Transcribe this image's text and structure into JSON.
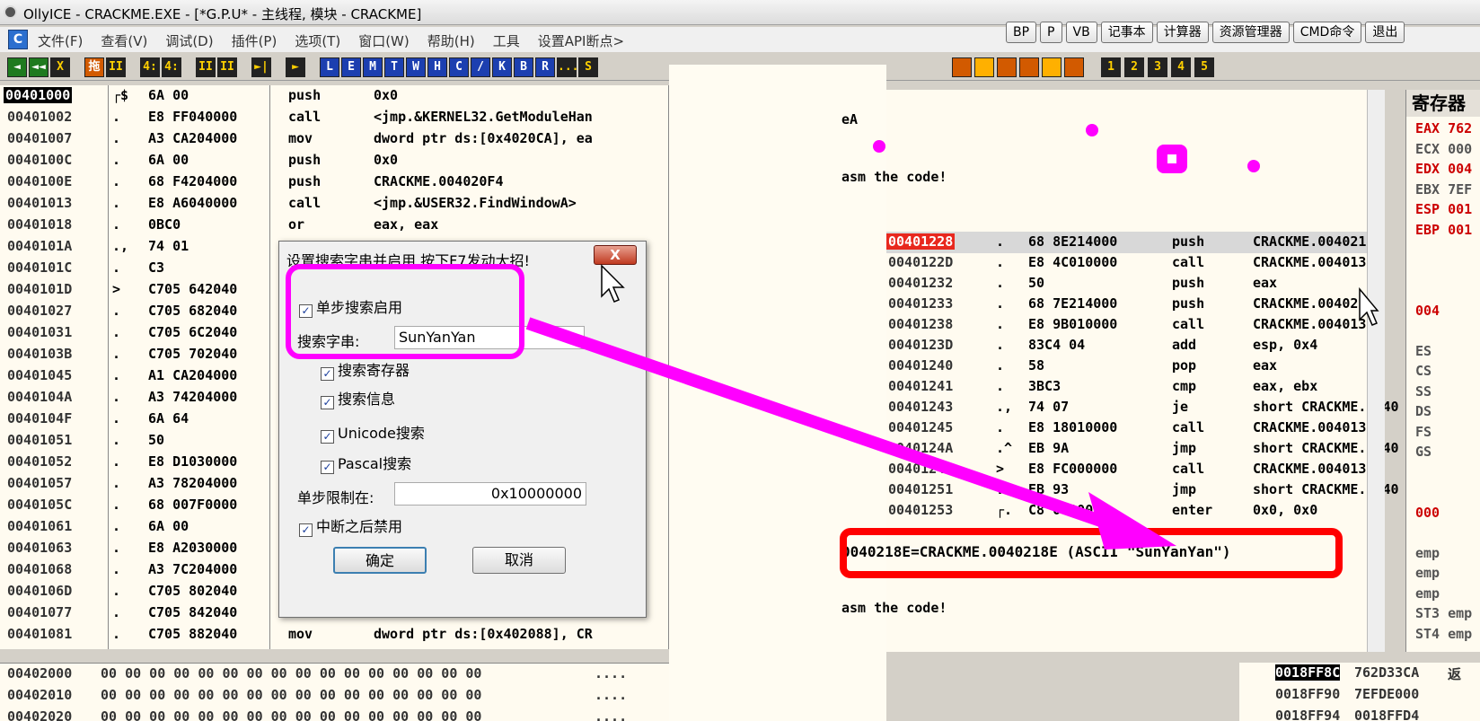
{
  "window": {
    "title": "OllyICE - CRACKME.EXE - [*G.P.U* -  主线程, 模块 - CRACKME]"
  },
  "menu": {
    "items": [
      "文件(F)",
      "查看(V)",
      "调试(D)",
      "插件(P)",
      "选项(T)",
      "窗口(W)",
      "帮助(H)",
      "工具",
      "设置API断点>"
    ]
  },
  "quick_buttons": [
    "BP",
    "P",
    "VB",
    "记事本",
    "计算器",
    "资源管理器",
    "CMD命令",
    "退出"
  ],
  "toolbar_left": [
    "◄",
    "◄◄",
    "X",
    "拖",
    "II",
    "4:",
    "4:",
    "II",
    "II",
    "►|",
    "►",
    "L",
    "E",
    "M",
    "T",
    "W",
    "H",
    "C",
    "/",
    "K",
    "B",
    "R",
    "...",
    "S"
  ],
  "toolbar_right": [
    "1",
    "2",
    "3",
    "4",
    "5"
  ],
  "disasm": [
    {
      "addr": "00401000",
      "sym": "┌$",
      "hex": "6A 00",
      "op": "push",
      "arg": "0x0",
      "sel": true
    },
    {
      "addr": "00401002",
      "sym": ".",
      "hex": "E8 FF040000",
      "op": "call",
      "arg": "<jmp.&KERNEL32.GetModuleHan"
    },
    {
      "addr": "00401007",
      "sym": ".",
      "hex": "A3 CA204000",
      "op": "mov",
      "arg": "dword ptr ds:[0x4020CA], ea"
    },
    {
      "addr": "0040100C",
      "sym": ".",
      "hex": "6A 00",
      "op": "push",
      "arg": "0x0"
    },
    {
      "addr": "0040100E",
      "sym": ".",
      "hex": "68 F4204000",
      "op": "push",
      "arg": "CRACKME.004020F4"
    },
    {
      "addr": "00401013",
      "sym": ".",
      "hex": "E8 A6040000",
      "op": "call",
      "arg": "<jmp.&USER32.FindWindowA>"
    },
    {
      "addr": "00401018",
      "sym": ".",
      "hex": "0BC0",
      "op": "or",
      "arg": "eax, eax"
    },
    {
      "addr": "0040101A",
      "sym": ".,",
      "hex": "74 01",
      "op": "",
      "arg": ""
    },
    {
      "addr": "0040101C",
      "sym": ".",
      "hex": "C3",
      "op": "",
      "arg": ""
    },
    {
      "addr": "0040101D",
      "sym": ">",
      "hex": "C705 642040",
      "op": "",
      "arg": ""
    },
    {
      "addr": "00401027",
      "sym": ".",
      "hex": "C705 682040",
      "op": "",
      "arg": ""
    },
    {
      "addr": "00401031",
      "sym": ".",
      "hex": "C705 6C2040",
      "op": "",
      "arg": ""
    },
    {
      "addr": "0040103B",
      "sym": ".",
      "hex": "C705 702040",
      "op": "",
      "arg": ""
    },
    {
      "addr": "00401045",
      "sym": ".",
      "hex": "A1 CA204000",
      "op": "",
      "arg": ""
    },
    {
      "addr": "0040104A",
      "sym": ".",
      "hex": "A3 74204000",
      "op": "",
      "arg": ""
    },
    {
      "addr": "0040104F",
      "sym": ".",
      "hex": "6A 64",
      "op": "",
      "arg": ""
    },
    {
      "addr": "00401051",
      "sym": ".",
      "hex": "50",
      "op": "",
      "arg": ""
    },
    {
      "addr": "00401052",
      "sym": ".",
      "hex": "E8 D1030000",
      "op": "",
      "arg": ""
    },
    {
      "addr": "00401057",
      "sym": ".",
      "hex": "A3 78204000",
      "op": "",
      "arg": ""
    },
    {
      "addr": "0040105C",
      "sym": ".",
      "hex": "68 007F0000",
      "op": "",
      "arg": ""
    },
    {
      "addr": "00401061",
      "sym": ".",
      "hex": "6A 00",
      "op": "",
      "arg": ""
    },
    {
      "addr": "00401063",
      "sym": ".",
      "hex": "E8 A2030000",
      "op": "",
      "arg": ""
    },
    {
      "addr": "00401068",
      "sym": ".",
      "hex": "A3 7C204000",
      "op": "",
      "arg": ""
    },
    {
      "addr": "0040106D",
      "sym": ".",
      "hex": "C705 802040",
      "op": "",
      "arg": ""
    },
    {
      "addr": "00401077",
      "sym": ".",
      "hex": "C705 842040",
      "op": "",
      "arg": ""
    },
    {
      "addr": "00401081",
      "sym": ".",
      "hex": "C705 882040",
      "op": "mov",
      "arg": "dword ptr ds:[0x402088], CR"
    }
  ],
  "right_disasm": [
    {
      "addr": "00401228",
      "sym": ".",
      "hex": "68 8E214000",
      "op": "push",
      "arg": "CRACKME.0040218E",
      "hl": true
    },
    {
      "addr": "0040122D",
      "sym": ".",
      "hex": "E8 4C010000",
      "op": "call",
      "arg": "CRACKME.0040137E"
    },
    {
      "addr": "00401232",
      "sym": ".",
      "hex": "50",
      "op": "push",
      "arg": "eax"
    },
    {
      "addr": "00401233",
      "sym": ".",
      "hex": "68 7E214000",
      "op": "push",
      "arg": "CRACKME.0040217E"
    },
    {
      "addr": "00401238",
      "sym": ".",
      "hex": "E8 9B010000",
      "op": "call",
      "arg": "CRACKME.004013D8"
    },
    {
      "addr": "0040123D",
      "sym": ".",
      "hex": "83C4 04",
      "op": "add",
      "arg": "esp, 0x4"
    },
    {
      "addr": "00401240",
      "sym": ".",
      "hex": "58",
      "op": "pop",
      "arg": "eax"
    },
    {
      "addr": "00401241",
      "sym": ".",
      "hex": "3BC3",
      "op": "cmp",
      "arg": "eax, ebx"
    },
    {
      "addr": "00401243",
      "sym": ".,",
      "hex": "74 07",
      "op": "je",
      "arg": "short CRACKME.0040"
    },
    {
      "addr": "00401245",
      "sym": ".",
      "hex": "E8 18010000",
      "op": "call",
      "arg": "CRACKME.00401362"
    },
    {
      "addr": "0040124A",
      "sym": ".^",
      "hex": "EB 9A",
      "op": "jmp",
      "arg": "short CRACKME.0040"
    },
    {
      "addr": "0040124C",
      "sym": ">",
      "hex": "E8 FC000000",
      "op": "call",
      "arg": "CRACKME.0040134D"
    },
    {
      "addr": "00401251",
      "sym": ".^",
      "hex": "EB 93",
      "op": "jmp",
      "arg": "short CRACKME.0040"
    },
    {
      "addr": "00401253",
      "sym": "┌.",
      "hex": "C8 000000",
      "op": "enter",
      "arg": "0x0, 0x0"
    }
  ],
  "right_top": {
    "line1": "eA",
    "line2": "asm the code!"
  },
  "right_bottom": {
    "hint": "asm the code!"
  },
  "info_line": "0040218E=CRACKME.0040218E (ASCII \"SunYanYan\")",
  "registers": {
    "header": "寄存器",
    "rows": [
      "EAX 762",
      "ECX 000",
      "EDX 004",
      "EBX 7EF",
      "ESP 001",
      "EBP 001",
      "",
      "",
      "",
      "004",
      "",
      "ES",
      "CS",
      "SS",
      "DS",
      "FS",
      "GS",
      "",
      "",
      "000",
      "",
      "emp",
      "emp",
      "emp",
      "ST3 emp",
      "ST4 emp"
    ]
  },
  "dump": {
    "rows": [
      {
        "addr": "00402000",
        "bytes": "00 00 00 00 00 00 00 00 00 00 00 00 00 00 00 00",
        "ascii": "...."
      },
      {
        "addr": "00402010",
        "bytes": "00 00 00 00 00 00 00 00 00 00 00 00 00 00 00 00",
        "ascii": "...."
      },
      {
        "addr": "00402020",
        "bytes": "00 00 00 00 00 00 00 00 00 00 00 00 00 00 00 00",
        "ascii": "...."
      }
    ]
  },
  "stack": {
    "rows": [
      {
        "addr": "0018FF8C",
        "val": "762D33CA",
        "cmt": "返",
        "sel": true
      },
      {
        "addr": "0018FF90",
        "val": "7EFDE000",
        "cmt": ""
      },
      {
        "addr": "0018FF94",
        "val": "0018FFD4",
        "cmt": ""
      }
    ]
  },
  "dialog": {
    "title": "设置搜索字串并启用,按下F7发动大招!",
    "close": "X",
    "enable_step_search": "单步搜索启用",
    "search_label": "搜索字串:",
    "search_value": "SunYanYan",
    "search_registers": "搜索寄存器",
    "search_info": "搜索信息",
    "unicode_search": "Unicode搜索",
    "pascal_search": "Pascal搜索",
    "step_limit_label": "单步限制在:",
    "step_limit_value": "0x10000000",
    "disable_after_break": "中断之后禁用",
    "ok": "确定",
    "cancel": "取消"
  }
}
